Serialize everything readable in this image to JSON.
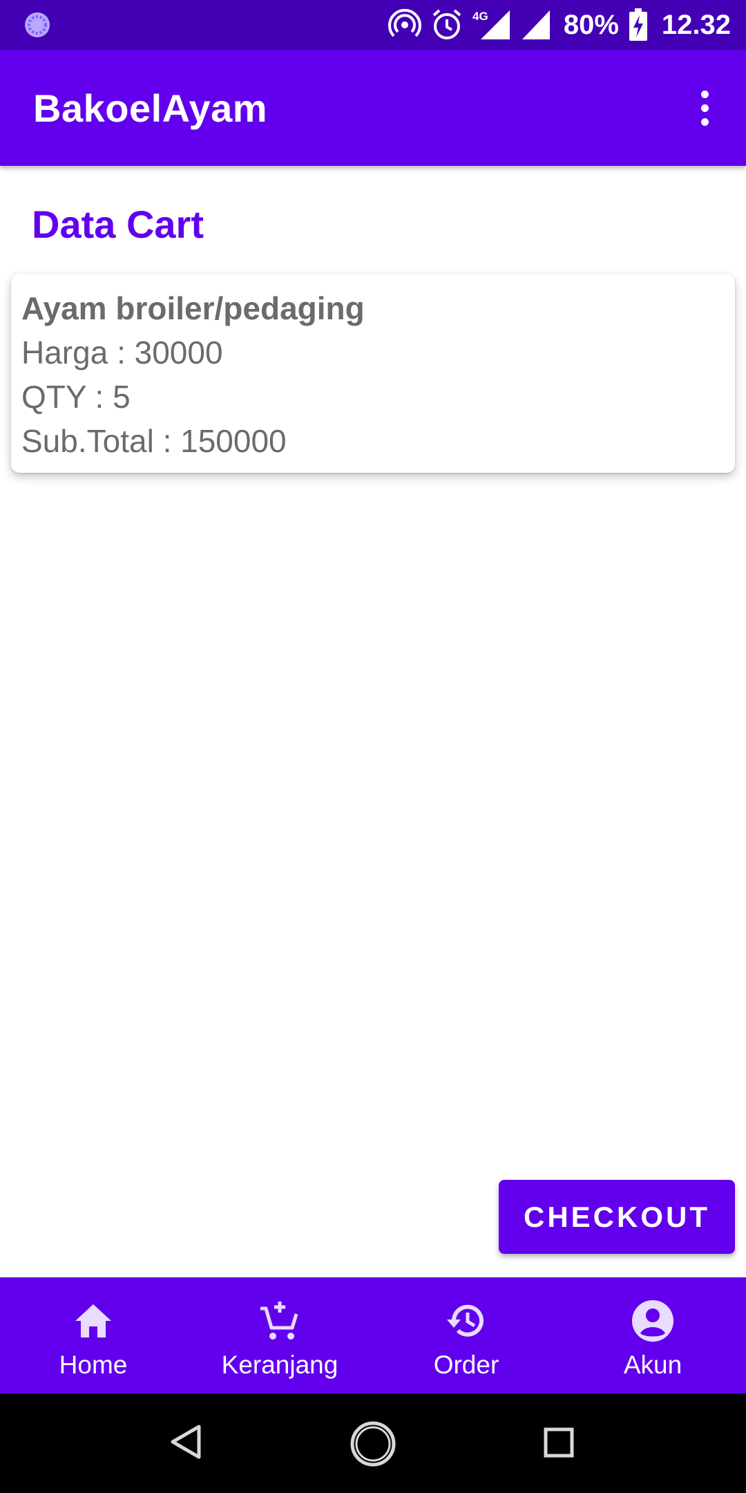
{
  "status_bar": {
    "battery": "80%",
    "time": "12.32",
    "network": "4G",
    "icons": [
      "app-indicator-icon",
      "hotspot-icon",
      "alarm-icon",
      "signal-icon",
      "battery-charging-icon"
    ]
  },
  "app_bar": {
    "title": "BakoelAyam",
    "menu_icon": "more-vert-icon"
  },
  "page": {
    "title": "Data Cart"
  },
  "cart": {
    "items": [
      {
        "name": "Ayam broiler/pedaging",
        "price_text": "Harga : 30000",
        "qty_text": "QTY : 5",
        "subtotal_text": "Sub.Total : 150000"
      }
    ]
  },
  "checkout_button": {
    "label": "CHECKOUT"
  },
  "bottom_nav": {
    "items": [
      {
        "label": "Home",
        "icon": "home-icon"
      },
      {
        "label": "Keranjang",
        "icon": "cart-add-icon"
      },
      {
        "label": "Order",
        "icon": "history-icon"
      },
      {
        "label": "Akun",
        "icon": "account-circle-icon"
      }
    ]
  },
  "colors": {
    "primary": "#6200ee",
    "status_bar": "#4300b5",
    "text_gray": "#6b6b6b"
  }
}
